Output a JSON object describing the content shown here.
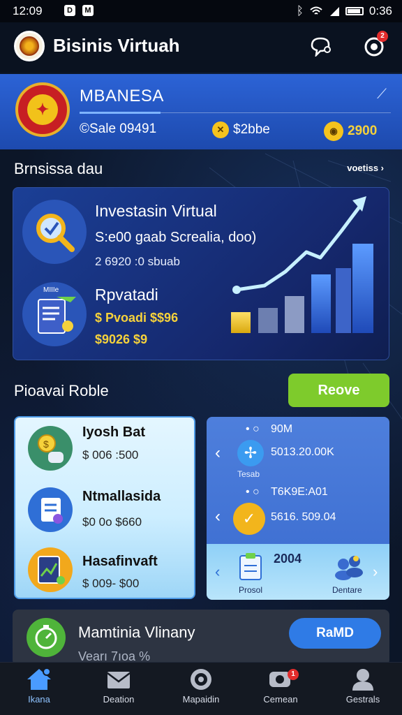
{
  "status_bar": {
    "time_left": "12:09",
    "time_right": "0:36",
    "icon_a": "D",
    "icon_b": "M"
  },
  "header": {
    "title": "Bisinis Virtuah",
    "notification_count": "2"
  },
  "banner": {
    "name": "MBANESA",
    "stat1": "©Sale 09491",
    "stat2": "$2bbe",
    "stat3": "2900"
  },
  "section1": {
    "title": "Brnsissa dau",
    "link": "voetiss ›"
  },
  "invest_card": {
    "title": "Investasin Virtual",
    "subtitle": "S:e00 gaab Screalia, doo)",
    "subtitle2": "2 6920 :0 sbuab",
    "title2": "Rpvatadi",
    "line1": "$ Pvoadi $$96",
    "line2": "$9026 $9",
    "badge_label": "MIIIe"
  },
  "section2": {
    "title": "Pioavai Roble",
    "button": "Reove"
  },
  "list_items": [
    {
      "title": "Iyosh Bat",
      "value": "$ 006 :500"
    },
    {
      "title": "Ntmallasida",
      "value": "$0 0o $660"
    },
    {
      "title": "Hasafinvaft",
      "value": "$ 009- $00"
    }
  ],
  "exchange_card": {
    "row1_top": "90M",
    "row1_value": "5013.20.00K",
    "row1_label": "Tesab",
    "row2_top": "T6K9E:A01",
    "row2_value": "5616. 509.04",
    "row3_value": "2004",
    "row3_label_left": "Prosol",
    "row3_label_right": "Dentare"
  },
  "promo": {
    "title": "Mamtinia Vlinany",
    "subtitle": "Vearı 7ıoa %",
    "button": "RaMD"
  },
  "bottom_nav": [
    {
      "label": "Ikana",
      "icon": "home-icon",
      "active": true
    },
    {
      "label": "Deation",
      "icon": "mail-icon",
      "active": false
    },
    {
      "label": "Mapaidin",
      "icon": "target-icon",
      "active": false
    },
    {
      "label": "Cemean",
      "icon": "chat-icon",
      "active": false,
      "badge": "1"
    },
    {
      "label": "Gestrals",
      "icon": "profile-icon",
      "active": false
    }
  ],
  "colors": {
    "banner_blue": "#2c63d6",
    "accent_green": "#7ecb2c",
    "accent_yellow": "#f6d23b",
    "nav_active": "#8fc3ff"
  }
}
